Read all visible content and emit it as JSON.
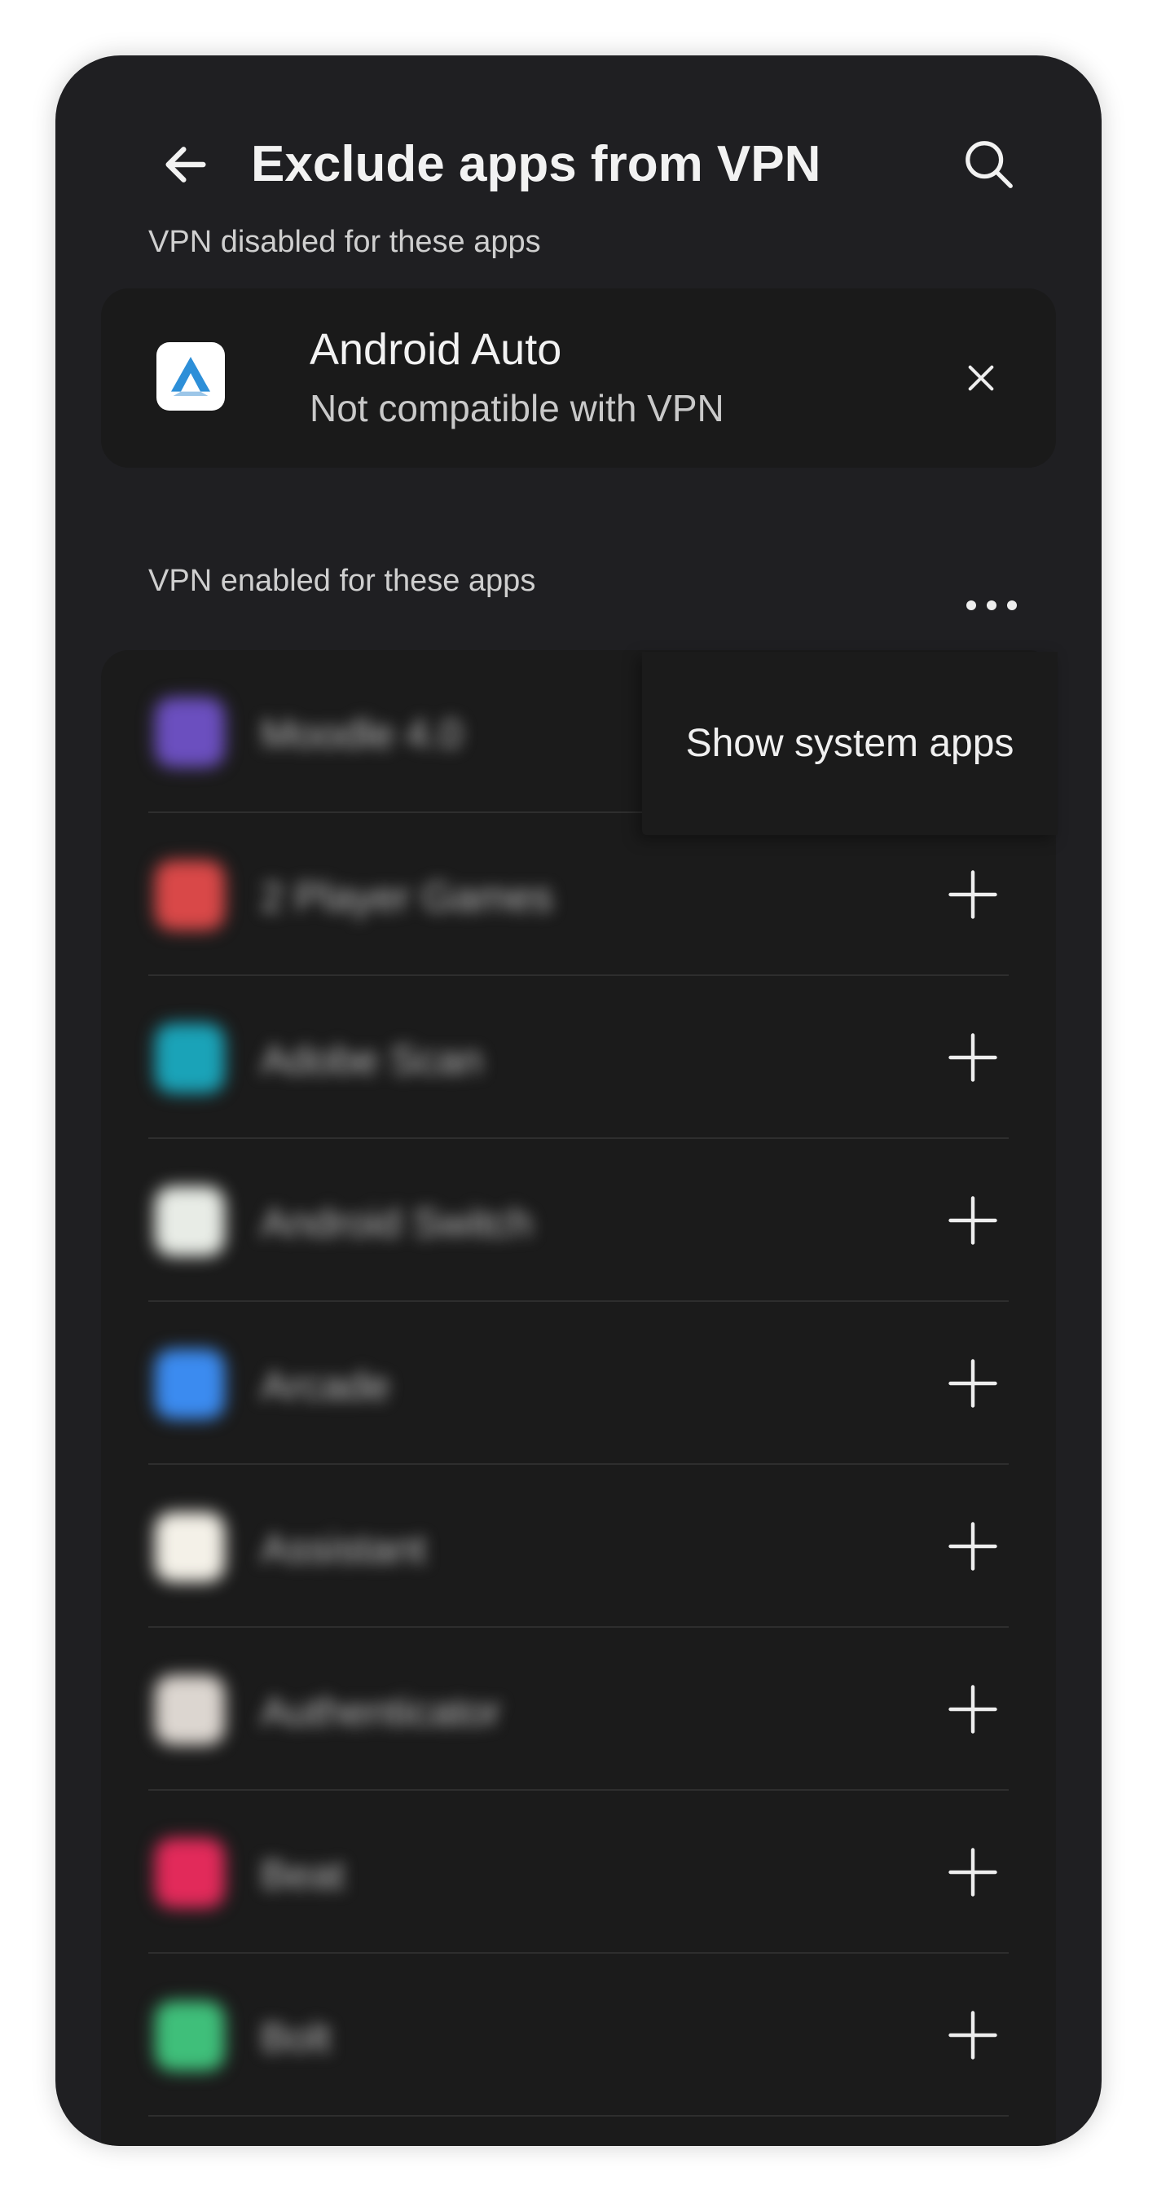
{
  "header": {
    "title": "Exclude apps from VPN",
    "back_icon": "arrow-left-icon",
    "search_icon": "search-icon"
  },
  "disabled_section": {
    "label": "VPN disabled for these apps",
    "app": {
      "name": "Android Auto",
      "status": "Not compatible with VPN",
      "icon": "android-auto-icon",
      "remove_icon": "close-icon"
    }
  },
  "enabled_section": {
    "label": "VPN enabled for these apps",
    "more_icon": "more-horizontal-icon",
    "apps": [
      {
        "name": "Moodle 4.0",
        "color": "#6b4fbf"
      },
      {
        "name": "2 Player Games",
        "color": "#d94848"
      },
      {
        "name": "Adobe Scan",
        "color": "#1aa3b8"
      },
      {
        "name": "Android Switch",
        "color": "#e8ece6"
      },
      {
        "name": "Arcade",
        "color": "#3b8bf0"
      },
      {
        "name": "Assistant",
        "color": "#f4f1e8"
      },
      {
        "name": "Authenticator",
        "color": "#dcd6d0"
      },
      {
        "name": "Beat",
        "color": "#e22a5a"
      },
      {
        "name": "Bolt",
        "color": "#3fbf7a"
      }
    ],
    "add_icon": "plus-icon"
  },
  "menu": {
    "items": [
      {
        "label": "Show system apps"
      }
    ]
  },
  "colors": {
    "background": "#1f1f22",
    "card": "#1a1a1a",
    "text_primary": "#f2f2f2",
    "text_secondary": "#cfcfcf",
    "android_auto_blue": "#2d8fd8"
  }
}
